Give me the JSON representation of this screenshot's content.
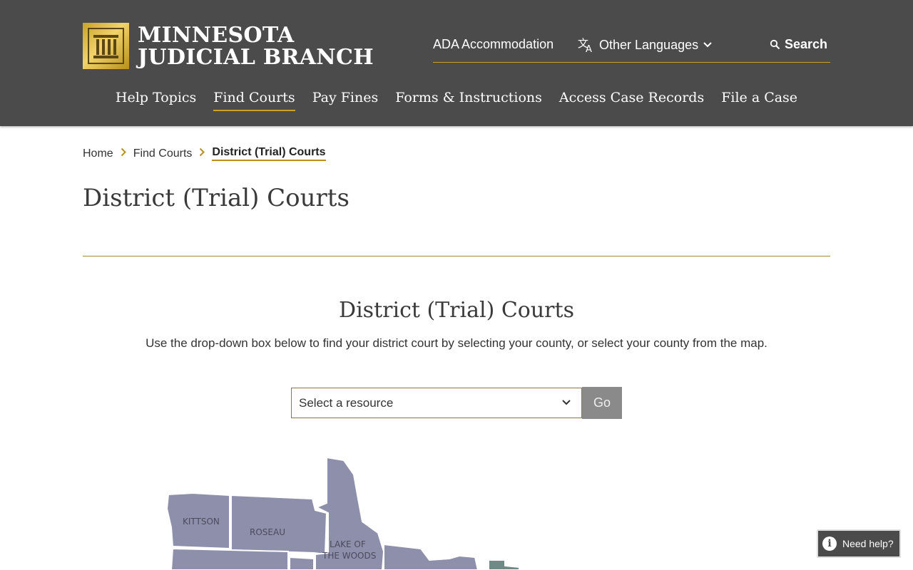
{
  "site": {
    "logo_line1": "MINNESOTA",
    "logo_line2": "JUDICIAL BRANCH"
  },
  "utility_nav": {
    "ada": "ADA Accommodation",
    "languages": "Other Languages",
    "search": "Search"
  },
  "main_nav": {
    "items": [
      {
        "label": "Help Topics"
      },
      {
        "label": "Find Courts",
        "active": true
      },
      {
        "label": "Pay Fines"
      },
      {
        "label": "Forms & Instructions"
      },
      {
        "label": "Access Case Records"
      },
      {
        "label": "File a Case"
      }
    ]
  },
  "breadcrumb": {
    "items": [
      "Home",
      "Find Courts",
      "District (Trial) Courts"
    ]
  },
  "page": {
    "title": "District (Trial) Courts",
    "section_title": "District (Trial) Courts",
    "description": "Use the drop-down box below to find your district court by selecting your county, or select your county from the map."
  },
  "finder": {
    "select_value": "Select a resource",
    "go_label": "Go"
  },
  "map": {
    "counties": [
      "KITTSON",
      "ROSEAU",
      "LAKE OF",
      "THE WOODS"
    ]
  },
  "help_widget": {
    "label": "Need help?"
  },
  "colors": {
    "header_bg": "#4b4b4b",
    "accent_gold": "#c9a227",
    "map_county": "#8e8fab",
    "map_county_alt": "#6f8a84"
  }
}
